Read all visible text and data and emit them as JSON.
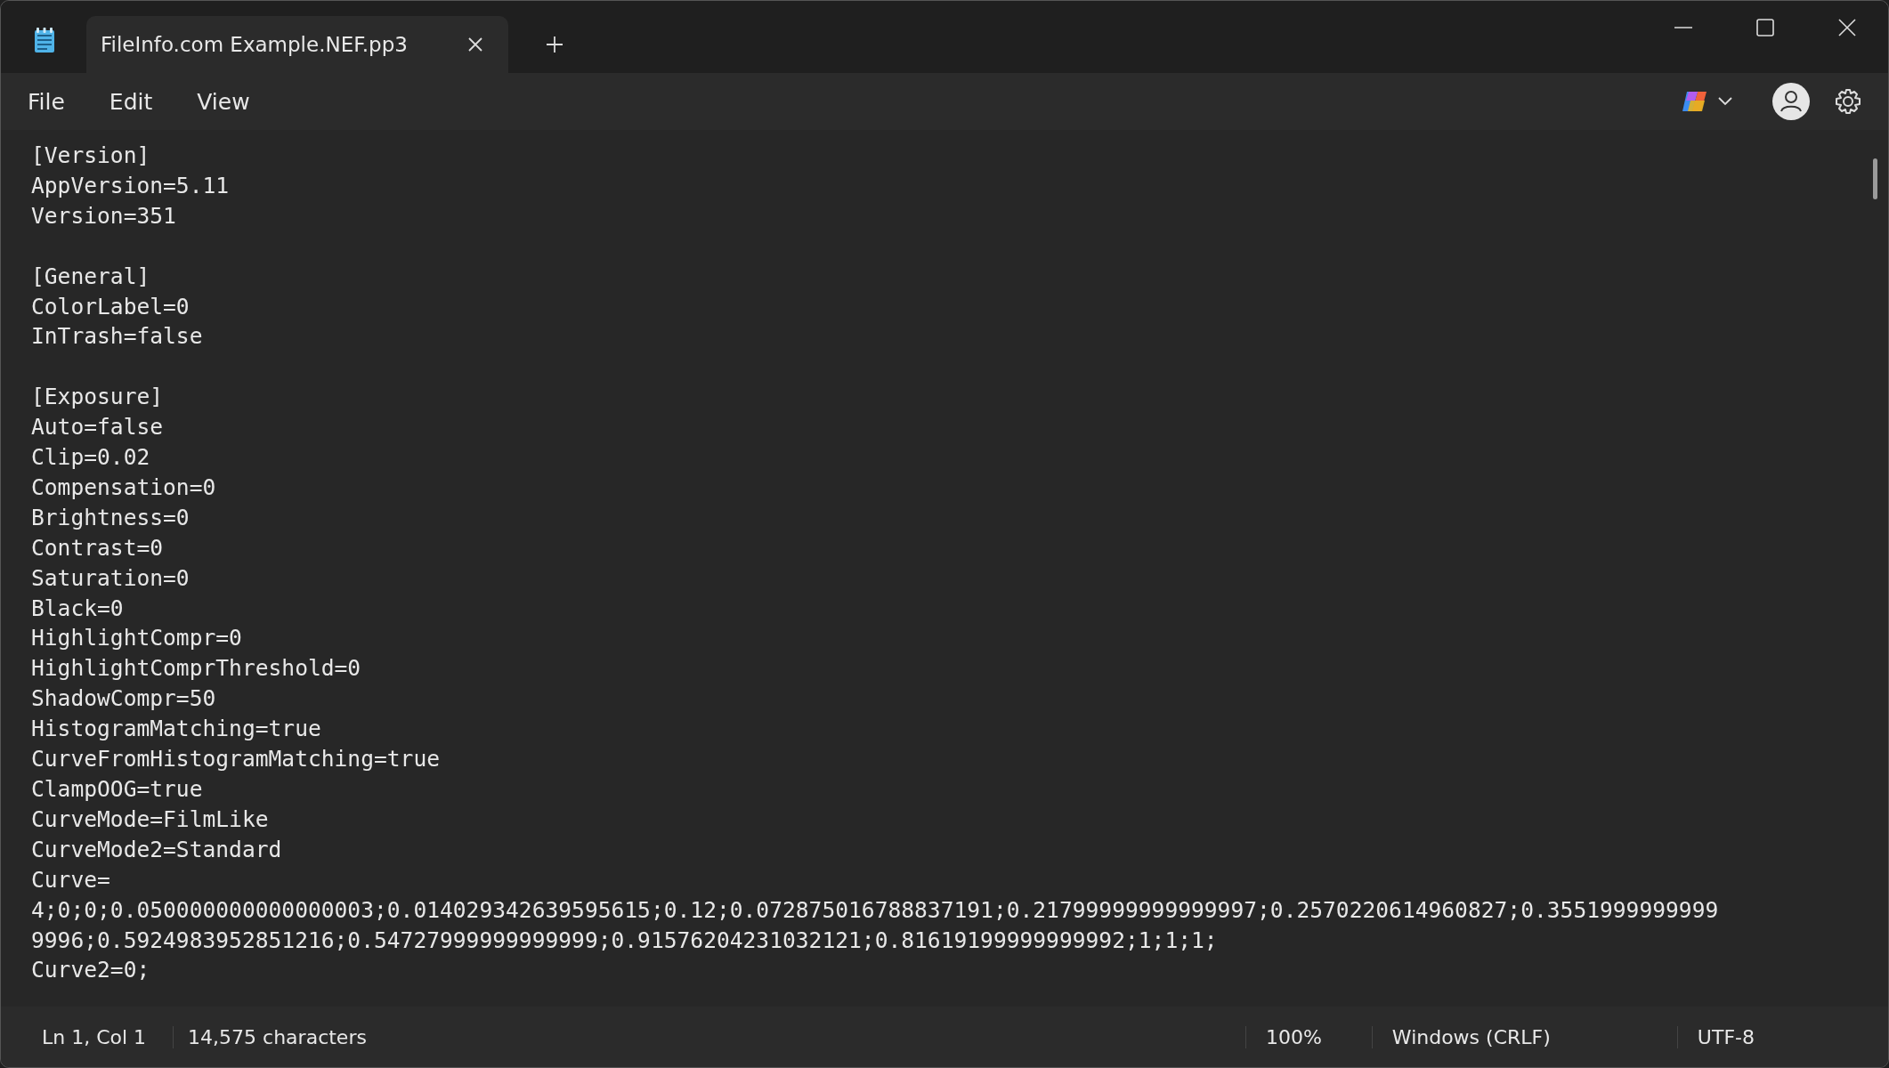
{
  "window": {
    "tab_title": "FileInfo.com Example.NEF.pp3"
  },
  "menu": [
    "File",
    "Edit",
    "View"
  ],
  "document": {
    "sections": [
      {
        "lines": [
          "[Version]",
          "AppVersion=5.11",
          "Version=351"
        ]
      },
      {
        "lines": [
          "[General]",
          "ColorLabel=0",
          "InTrash=false"
        ]
      },
      {
        "lines": [
          "[Exposure]",
          "Auto=false",
          "Clip=0.02",
          "Compensation=0",
          "Brightness=0",
          "Contrast=0",
          "Saturation=0",
          "Black=0",
          "HighlightCompr=0",
          "HighlightComprThreshold=0",
          "ShadowCompr=50",
          "HistogramMatching=true",
          "CurveFromHistogramMatching=true",
          "ClampOOG=true",
          "CurveMode=FilmLike",
          "CurveMode2=Standard",
          "Curve=",
          "4;0;0;0.050000000000000003;0.014029342639595615;0.12;0.072875016788837191;0.21799999999999997;0.2570220614960827;0.3551999999999",
          "9996;0.5924983952851216;0.54727999999999999;0.91576204231032121;0.81619199999999992;1;1;1;",
          "Curve2=0;"
        ]
      }
    ]
  },
  "status_bar": {
    "position": "Ln 1, Col 1",
    "characters": "14,575 characters",
    "zoom": "100%",
    "line_endings": "Windows (CRLF)",
    "encoding": "UTF-8"
  }
}
